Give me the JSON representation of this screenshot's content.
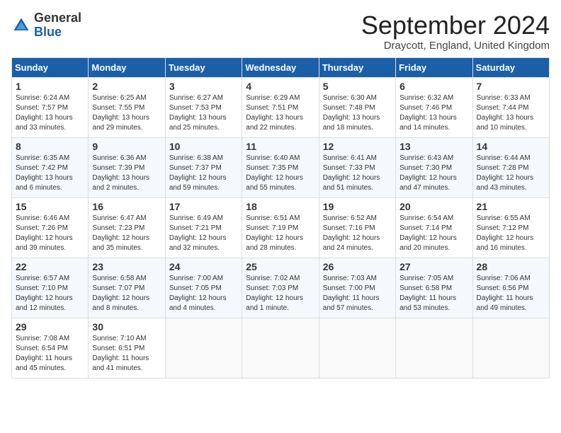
{
  "header": {
    "logo_general": "General",
    "logo_blue": "Blue",
    "month_title": "September 2024",
    "location": "Draycott, England, United Kingdom"
  },
  "columns": [
    "Sunday",
    "Monday",
    "Tuesday",
    "Wednesday",
    "Thursday",
    "Friday",
    "Saturday"
  ],
  "weeks": [
    [
      {
        "day": "1",
        "sunrise": "Sunrise: 6:24 AM",
        "sunset": "Sunset: 7:57 PM",
        "daylight": "Daylight: 13 hours and 33 minutes."
      },
      {
        "day": "2",
        "sunrise": "Sunrise: 6:25 AM",
        "sunset": "Sunset: 7:55 PM",
        "daylight": "Daylight: 13 hours and 29 minutes."
      },
      {
        "day": "3",
        "sunrise": "Sunrise: 6:27 AM",
        "sunset": "Sunset: 7:53 PM",
        "daylight": "Daylight: 13 hours and 25 minutes."
      },
      {
        "day": "4",
        "sunrise": "Sunrise: 6:29 AM",
        "sunset": "Sunset: 7:51 PM",
        "daylight": "Daylight: 13 hours and 22 minutes."
      },
      {
        "day": "5",
        "sunrise": "Sunrise: 6:30 AM",
        "sunset": "Sunset: 7:48 PM",
        "daylight": "Daylight: 13 hours and 18 minutes."
      },
      {
        "day": "6",
        "sunrise": "Sunrise: 6:32 AM",
        "sunset": "Sunset: 7:46 PM",
        "daylight": "Daylight: 13 hours and 14 minutes."
      },
      {
        "day": "7",
        "sunrise": "Sunrise: 6:33 AM",
        "sunset": "Sunset: 7:44 PM",
        "daylight": "Daylight: 13 hours and 10 minutes."
      }
    ],
    [
      {
        "day": "8",
        "sunrise": "Sunrise: 6:35 AM",
        "sunset": "Sunset: 7:42 PM",
        "daylight": "Daylight: 13 hours and 6 minutes."
      },
      {
        "day": "9",
        "sunrise": "Sunrise: 6:36 AM",
        "sunset": "Sunset: 7:39 PM",
        "daylight": "Daylight: 13 hours and 2 minutes."
      },
      {
        "day": "10",
        "sunrise": "Sunrise: 6:38 AM",
        "sunset": "Sunset: 7:37 PM",
        "daylight": "Daylight: 12 hours and 59 minutes."
      },
      {
        "day": "11",
        "sunrise": "Sunrise: 6:40 AM",
        "sunset": "Sunset: 7:35 PM",
        "daylight": "Daylight: 12 hours and 55 minutes."
      },
      {
        "day": "12",
        "sunrise": "Sunrise: 6:41 AM",
        "sunset": "Sunset: 7:33 PM",
        "daylight": "Daylight: 12 hours and 51 minutes."
      },
      {
        "day": "13",
        "sunrise": "Sunrise: 6:43 AM",
        "sunset": "Sunset: 7:30 PM",
        "daylight": "Daylight: 12 hours and 47 minutes."
      },
      {
        "day": "14",
        "sunrise": "Sunrise: 6:44 AM",
        "sunset": "Sunset: 7:28 PM",
        "daylight": "Daylight: 12 hours and 43 minutes."
      }
    ],
    [
      {
        "day": "15",
        "sunrise": "Sunrise: 6:46 AM",
        "sunset": "Sunset: 7:26 PM",
        "daylight": "Daylight: 12 hours and 39 minutes."
      },
      {
        "day": "16",
        "sunrise": "Sunrise: 6:47 AM",
        "sunset": "Sunset: 7:23 PM",
        "daylight": "Daylight: 12 hours and 35 minutes."
      },
      {
        "day": "17",
        "sunrise": "Sunrise: 6:49 AM",
        "sunset": "Sunset: 7:21 PM",
        "daylight": "Daylight: 12 hours and 32 minutes."
      },
      {
        "day": "18",
        "sunrise": "Sunrise: 6:51 AM",
        "sunset": "Sunset: 7:19 PM",
        "daylight": "Daylight: 12 hours and 28 minutes."
      },
      {
        "day": "19",
        "sunrise": "Sunrise: 6:52 AM",
        "sunset": "Sunset: 7:16 PM",
        "daylight": "Daylight: 12 hours and 24 minutes."
      },
      {
        "day": "20",
        "sunrise": "Sunrise: 6:54 AM",
        "sunset": "Sunset: 7:14 PM",
        "daylight": "Daylight: 12 hours and 20 minutes."
      },
      {
        "day": "21",
        "sunrise": "Sunrise: 6:55 AM",
        "sunset": "Sunset: 7:12 PM",
        "daylight": "Daylight: 12 hours and 16 minutes."
      }
    ],
    [
      {
        "day": "22",
        "sunrise": "Sunrise: 6:57 AM",
        "sunset": "Sunset: 7:10 PM",
        "daylight": "Daylight: 12 hours and 12 minutes."
      },
      {
        "day": "23",
        "sunrise": "Sunrise: 6:58 AM",
        "sunset": "Sunset: 7:07 PM",
        "daylight": "Daylight: 12 hours and 8 minutes."
      },
      {
        "day": "24",
        "sunrise": "Sunrise: 7:00 AM",
        "sunset": "Sunset: 7:05 PM",
        "daylight": "Daylight: 12 hours and 4 minutes."
      },
      {
        "day": "25",
        "sunrise": "Sunrise: 7:02 AM",
        "sunset": "Sunset: 7:03 PM",
        "daylight": "Daylight: 12 hours and 1 minute."
      },
      {
        "day": "26",
        "sunrise": "Sunrise: 7:03 AM",
        "sunset": "Sunset: 7:00 PM",
        "daylight": "Daylight: 11 hours and 57 minutes."
      },
      {
        "day": "27",
        "sunrise": "Sunrise: 7:05 AM",
        "sunset": "Sunset: 6:58 PM",
        "daylight": "Daylight: 11 hours and 53 minutes."
      },
      {
        "day": "28",
        "sunrise": "Sunrise: 7:06 AM",
        "sunset": "Sunset: 6:56 PM",
        "daylight": "Daylight: 11 hours and 49 minutes."
      }
    ],
    [
      {
        "day": "29",
        "sunrise": "Sunrise: 7:08 AM",
        "sunset": "Sunset: 6:54 PM",
        "daylight": "Daylight: 11 hours and 45 minutes."
      },
      {
        "day": "30",
        "sunrise": "Sunrise: 7:10 AM",
        "sunset": "Sunset: 6:51 PM",
        "daylight": "Daylight: 11 hours and 41 minutes."
      },
      null,
      null,
      null,
      null,
      null
    ]
  ]
}
